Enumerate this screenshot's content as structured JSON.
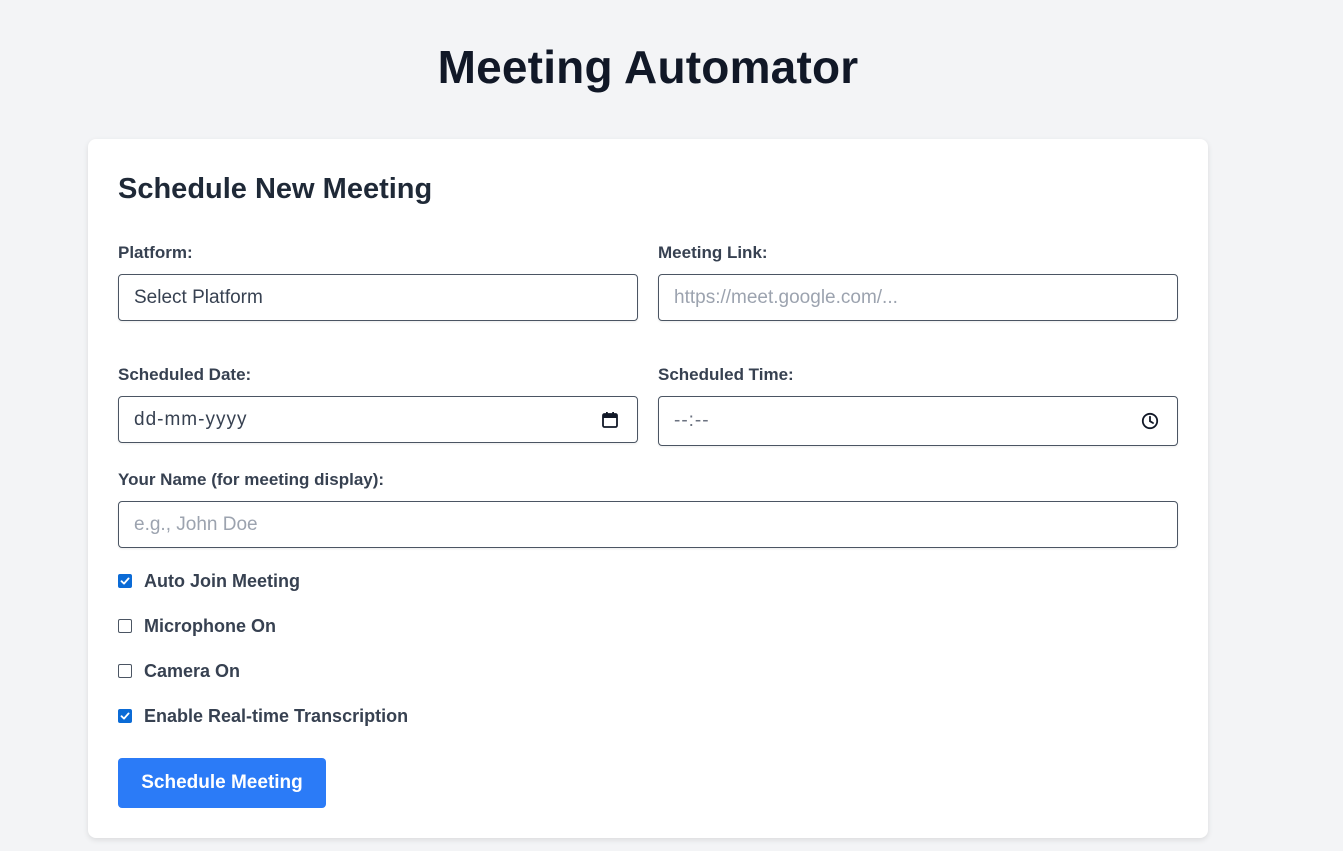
{
  "header": {
    "title": "Meeting Automator"
  },
  "form": {
    "title": "Schedule New Meeting",
    "platform": {
      "label": "Platform:",
      "value": "Select Platform"
    },
    "meeting_link": {
      "label": "Meeting Link:",
      "placeholder": "https://meet.google.com/..."
    },
    "date": {
      "label": "Scheduled Date:",
      "value": "dd-mm-yyyy",
      "icon": "calendar-icon"
    },
    "time": {
      "label": "Scheduled Time:",
      "value": "--:--",
      "icon": "clock-icon"
    },
    "name": {
      "label": "Your Name (for meeting display):",
      "placeholder": "e.g., John Doe"
    },
    "options": [
      {
        "label": "Auto Join Meeting",
        "checked": true
      },
      {
        "label": "Microphone On",
        "checked": false
      },
      {
        "label": "Camera On",
        "checked": false
      },
      {
        "label": "Enable Real-time Transcription",
        "checked": true
      }
    ],
    "submit_label": "Schedule Meeting"
  },
  "colors": {
    "accent": "#2b7bf7",
    "checkbox_checked": "#0b6bd6",
    "background": "#f3f4f6",
    "card": "#ffffff"
  }
}
